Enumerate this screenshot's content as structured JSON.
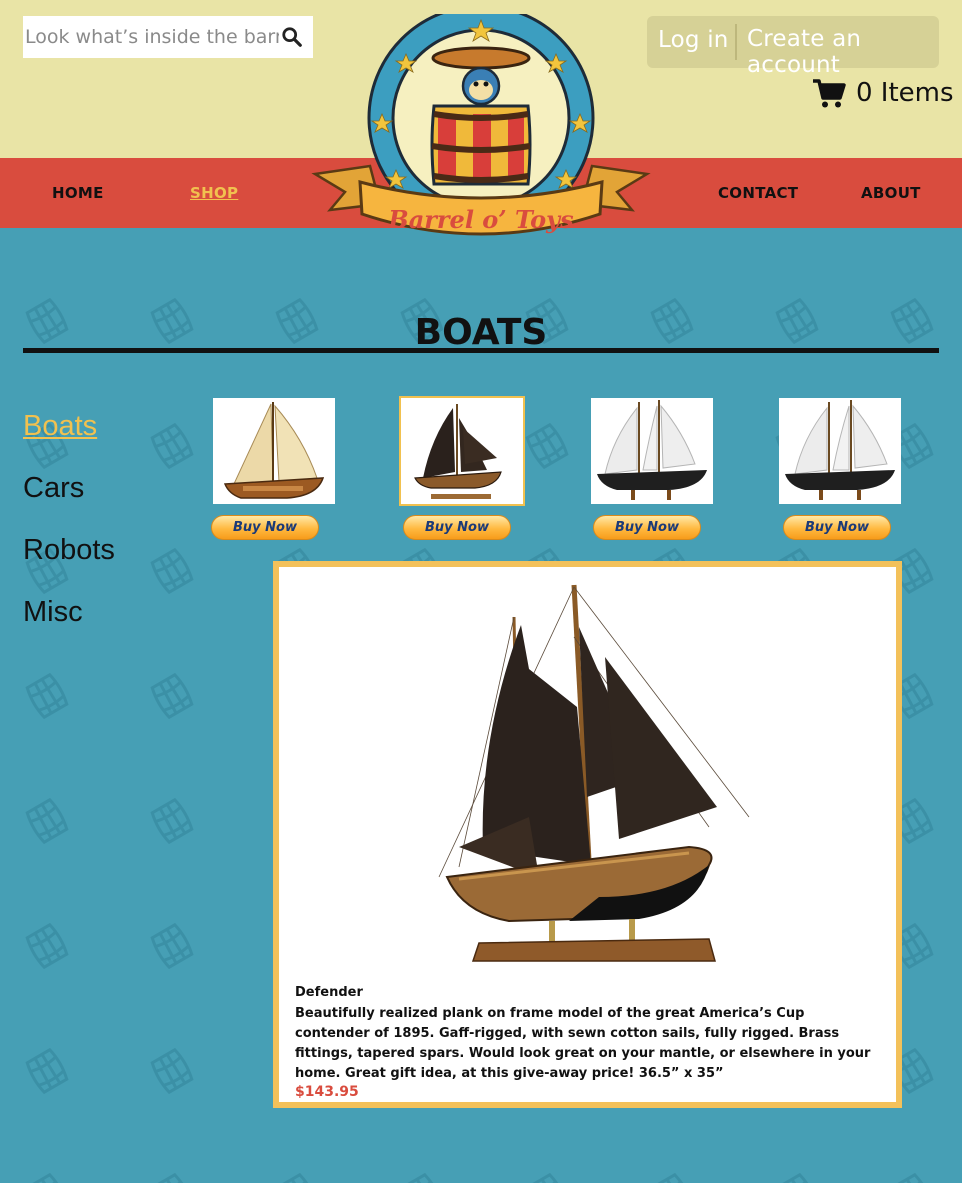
{
  "search": {
    "placeholder": "Look what’s inside the barrel."
  },
  "account": {
    "login_label": "Log in",
    "create_label": "Create an account"
  },
  "cart": {
    "label": "0 Items"
  },
  "nav": {
    "home": "HOME",
    "shop": "SHOP",
    "contact": "CONTACT",
    "about": "ABOUT"
  },
  "logo": {
    "text": "Barrel o’ Toys"
  },
  "page": {
    "title": "BOATS"
  },
  "sidebar": {
    "items": [
      {
        "label": "Boats"
      },
      {
        "label": "Cars"
      },
      {
        "label": "Robots"
      },
      {
        "label": "Misc"
      }
    ]
  },
  "products": {
    "buy_label": "Buy Now"
  },
  "detail": {
    "name": "Defender",
    "description": "Beautifully realized plank on frame model of the great America’s Cup contender of 1895. Gaff-rigged, with sewn cotton sails, fully rigged. Brass fittings, tapered spars. Would look great on your mantle, or elsewhere in your home. Great gift idea, at this give-away price! 36.5” x 35”",
    "price": "$143.95"
  },
  "colors": {
    "header_bg": "#e9e4a6",
    "nav_bg": "#d94c3e",
    "body_bg": "#469fb5",
    "accent": "#f1c14f"
  }
}
